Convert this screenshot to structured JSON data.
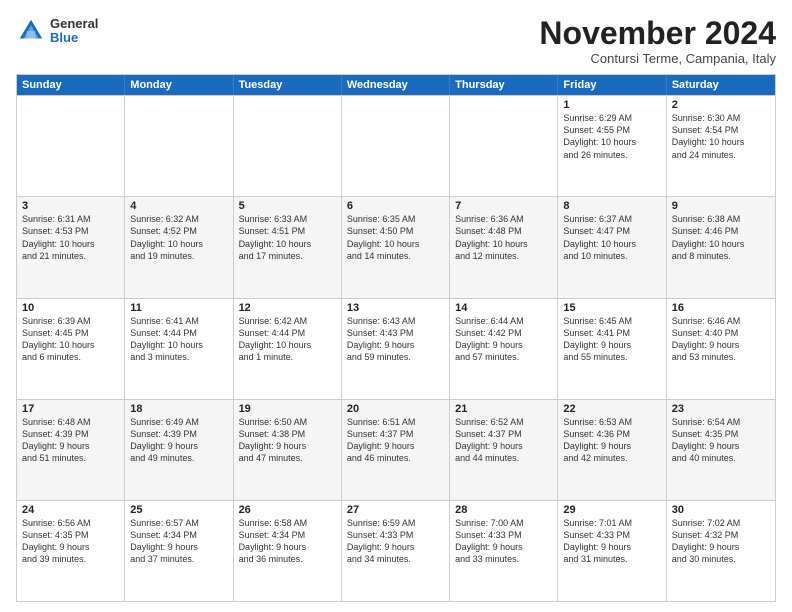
{
  "logo": {
    "general": "General",
    "blue": "Blue"
  },
  "title": "November 2024",
  "subtitle": "Contursi Terme, Campania, Italy",
  "days": [
    "Sunday",
    "Monday",
    "Tuesday",
    "Wednesday",
    "Thursday",
    "Friday",
    "Saturday"
  ],
  "weeks": [
    [
      {
        "day": "",
        "info": ""
      },
      {
        "day": "",
        "info": ""
      },
      {
        "day": "",
        "info": ""
      },
      {
        "day": "",
        "info": ""
      },
      {
        "day": "",
        "info": ""
      },
      {
        "day": "1",
        "info": "Sunrise: 6:29 AM\nSunset: 4:55 PM\nDaylight: 10 hours\nand 26 minutes."
      },
      {
        "day": "2",
        "info": "Sunrise: 6:30 AM\nSunset: 4:54 PM\nDaylight: 10 hours\nand 24 minutes."
      }
    ],
    [
      {
        "day": "3",
        "info": "Sunrise: 6:31 AM\nSunset: 4:53 PM\nDaylight: 10 hours\nand 21 minutes."
      },
      {
        "day": "4",
        "info": "Sunrise: 6:32 AM\nSunset: 4:52 PM\nDaylight: 10 hours\nand 19 minutes."
      },
      {
        "day": "5",
        "info": "Sunrise: 6:33 AM\nSunset: 4:51 PM\nDaylight: 10 hours\nand 17 minutes."
      },
      {
        "day": "6",
        "info": "Sunrise: 6:35 AM\nSunset: 4:50 PM\nDaylight: 10 hours\nand 14 minutes."
      },
      {
        "day": "7",
        "info": "Sunrise: 6:36 AM\nSunset: 4:48 PM\nDaylight: 10 hours\nand 12 minutes."
      },
      {
        "day": "8",
        "info": "Sunrise: 6:37 AM\nSunset: 4:47 PM\nDaylight: 10 hours\nand 10 minutes."
      },
      {
        "day": "9",
        "info": "Sunrise: 6:38 AM\nSunset: 4:46 PM\nDaylight: 10 hours\nand 8 minutes."
      }
    ],
    [
      {
        "day": "10",
        "info": "Sunrise: 6:39 AM\nSunset: 4:45 PM\nDaylight: 10 hours\nand 6 minutes."
      },
      {
        "day": "11",
        "info": "Sunrise: 6:41 AM\nSunset: 4:44 PM\nDaylight: 10 hours\nand 3 minutes."
      },
      {
        "day": "12",
        "info": "Sunrise: 6:42 AM\nSunset: 4:44 PM\nDaylight: 10 hours\nand 1 minute."
      },
      {
        "day": "13",
        "info": "Sunrise: 6:43 AM\nSunset: 4:43 PM\nDaylight: 9 hours\nand 59 minutes."
      },
      {
        "day": "14",
        "info": "Sunrise: 6:44 AM\nSunset: 4:42 PM\nDaylight: 9 hours\nand 57 minutes."
      },
      {
        "day": "15",
        "info": "Sunrise: 6:45 AM\nSunset: 4:41 PM\nDaylight: 9 hours\nand 55 minutes."
      },
      {
        "day": "16",
        "info": "Sunrise: 6:46 AM\nSunset: 4:40 PM\nDaylight: 9 hours\nand 53 minutes."
      }
    ],
    [
      {
        "day": "17",
        "info": "Sunrise: 6:48 AM\nSunset: 4:39 PM\nDaylight: 9 hours\nand 51 minutes."
      },
      {
        "day": "18",
        "info": "Sunrise: 6:49 AM\nSunset: 4:39 PM\nDaylight: 9 hours\nand 49 minutes."
      },
      {
        "day": "19",
        "info": "Sunrise: 6:50 AM\nSunset: 4:38 PM\nDaylight: 9 hours\nand 47 minutes."
      },
      {
        "day": "20",
        "info": "Sunrise: 6:51 AM\nSunset: 4:37 PM\nDaylight: 9 hours\nand 46 minutes."
      },
      {
        "day": "21",
        "info": "Sunrise: 6:52 AM\nSunset: 4:37 PM\nDaylight: 9 hours\nand 44 minutes."
      },
      {
        "day": "22",
        "info": "Sunrise: 6:53 AM\nSunset: 4:36 PM\nDaylight: 9 hours\nand 42 minutes."
      },
      {
        "day": "23",
        "info": "Sunrise: 6:54 AM\nSunset: 4:35 PM\nDaylight: 9 hours\nand 40 minutes."
      }
    ],
    [
      {
        "day": "24",
        "info": "Sunrise: 6:56 AM\nSunset: 4:35 PM\nDaylight: 9 hours\nand 39 minutes."
      },
      {
        "day": "25",
        "info": "Sunrise: 6:57 AM\nSunset: 4:34 PM\nDaylight: 9 hours\nand 37 minutes."
      },
      {
        "day": "26",
        "info": "Sunrise: 6:58 AM\nSunset: 4:34 PM\nDaylight: 9 hours\nand 36 minutes."
      },
      {
        "day": "27",
        "info": "Sunrise: 6:59 AM\nSunset: 4:33 PM\nDaylight: 9 hours\nand 34 minutes."
      },
      {
        "day": "28",
        "info": "Sunrise: 7:00 AM\nSunset: 4:33 PM\nDaylight: 9 hours\nand 33 minutes."
      },
      {
        "day": "29",
        "info": "Sunrise: 7:01 AM\nSunset: 4:33 PM\nDaylight: 9 hours\nand 31 minutes."
      },
      {
        "day": "30",
        "info": "Sunrise: 7:02 AM\nSunset: 4:32 PM\nDaylight: 9 hours\nand 30 minutes."
      }
    ]
  ]
}
